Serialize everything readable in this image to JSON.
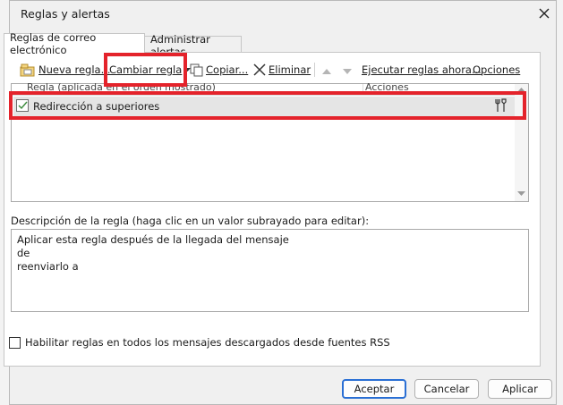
{
  "window": {
    "title": "Reglas y alertas"
  },
  "tabs": [
    {
      "label": "Reglas de correo electrónico",
      "active": true
    },
    {
      "label": "Administrar alertas",
      "active": false
    }
  ],
  "toolbar": {
    "new_rule": "Nueva regla...",
    "change_rule": "Cambiar regla",
    "copy": "Copiar...",
    "delete": "Eliminar",
    "run_rules": "Ejecutar reglas ahora...",
    "options": "Opciones"
  },
  "rules_list": {
    "columns": [
      "Regla (aplicada en el orden mostrado)",
      "Acciones"
    ],
    "rows": [
      {
        "name": "Redirección a superiores",
        "enabled": true,
        "selected": true
      }
    ]
  },
  "description": {
    "label": "Descripción de la regla (haga clic en un valor subrayado para editar):",
    "lines": [
      "Aplicar esta regla después de la llegada del mensaje",
      "de",
      "reenviarlo a"
    ]
  },
  "rss": {
    "label": "Habilitar reglas en todos los mensajes descargados desde fuentes RSS",
    "checked": false
  },
  "buttons": {
    "ok": "Aceptar",
    "cancel": "Cancelar",
    "apply": "Aplicar"
  },
  "colors": {
    "highlight": "#e4232b",
    "primary_border": "#2a6fd4"
  }
}
